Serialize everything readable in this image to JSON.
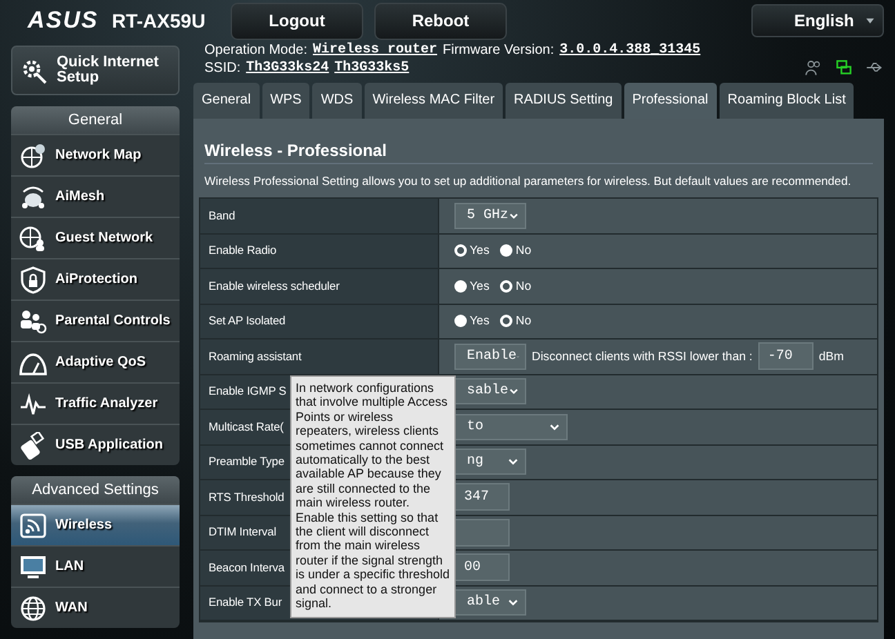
{
  "header": {
    "logo": "ASUS",
    "model": "RT-AX59U",
    "buttons": [
      "Logout",
      "Reboot"
    ],
    "language": "English"
  },
  "info": {
    "mode_label": "Operation Mode:",
    "mode": "Wireless router",
    "firmware_label": "Firmware Version:",
    "firmware": "3.0.0.4.388_31345",
    "ssid_label": "SSID:",
    "ssids": [
      "Th3G33ks24",
      "Th3G33ks5"
    ]
  },
  "sidebar": {
    "quick_setup": "Quick Internet Setup",
    "general_title": "General",
    "general_items": [
      {
        "label": "Network Map",
        "selected": false
      },
      {
        "label": "AiMesh",
        "selected": false
      },
      {
        "label": "Guest Network",
        "selected": false
      },
      {
        "label": "AiProtection",
        "selected": false
      },
      {
        "label": "Parental Controls",
        "selected": false
      },
      {
        "label": "Adaptive QoS",
        "selected": false
      },
      {
        "label": "Traffic Analyzer",
        "selected": false
      },
      {
        "label": "USB Application",
        "selected": false
      }
    ],
    "advanced_title": "Advanced Settings",
    "advanced_items": [
      {
        "label": "Wireless",
        "selected": true
      },
      {
        "label": "LAN",
        "selected": false
      },
      {
        "label": "WAN",
        "selected": false
      }
    ]
  },
  "tabs": [
    {
      "label": "General",
      "selected": false
    },
    {
      "label": "WPS",
      "selected": false
    },
    {
      "label": "WDS",
      "selected": false
    },
    {
      "label": "Wireless MAC Filter",
      "selected": false
    },
    {
      "label": "RADIUS Setting",
      "selected": false
    },
    {
      "label": "Professional",
      "selected": true
    },
    {
      "label": "Roaming Block List",
      "selected": false
    }
  ],
  "panel": {
    "title": "Wireless - Professional",
    "description": "Wireless Professional Setting allows you to set up additional parameters for wireless. But default values are recommended.",
    "rows": [
      {
        "label": "Band",
        "kind": "select",
        "value": "5 GHz"
      },
      {
        "label": "Enable Radio",
        "kind": "radio",
        "options": [
          {
            "label": "Yes",
            "selected": true
          },
          {
            "label": "No",
            "selected": false
          }
        ]
      },
      {
        "label": "Enable wireless scheduler",
        "kind": "radio",
        "options": [
          {
            "label": "Yes",
            "selected": false
          },
          {
            "label": "No",
            "selected": true
          }
        ]
      },
      {
        "label": "Set AP Isolated",
        "kind": "radio",
        "options": [
          {
            "label": "Yes",
            "selected": false
          },
          {
            "label": "No",
            "selected": true
          }
        ]
      },
      {
        "label": "Roaming assistant",
        "kind": "roaming",
        "value": "Enable",
        "text": "Disconnect clients with RSSI lower than :",
        "input": "-70",
        "unit": "dBm"
      },
      {
        "label": "Enable IGMP S",
        "kind": "select",
        "value": "sable"
      },
      {
        "label": "Multicast Rate(",
        "kind": "select-wide",
        "value": "to"
      },
      {
        "label": "Preamble Type",
        "kind": "select",
        "value": "ng"
      },
      {
        "label": "RTS Threshold",
        "kind": "input",
        "value": "347"
      },
      {
        "label": "DTIM Interval",
        "kind": "input"
      },
      {
        "label": "Beacon Interva",
        "kind": "input",
        "value": "00"
      },
      {
        "label": "Enable TX Bur",
        "kind": "select",
        "value": "able"
      }
    ],
    "tooltip": "In network configurations that involve multiple Access Points or wireless repeaters, wireless clients sometimes cannot connect automatically to the best available AP because they are still connected to the main wireless router. Enable this setting so that the client will disconnect from the main wireless router if the signal strength is under a specific threshold and connect to a stronger signal."
  }
}
